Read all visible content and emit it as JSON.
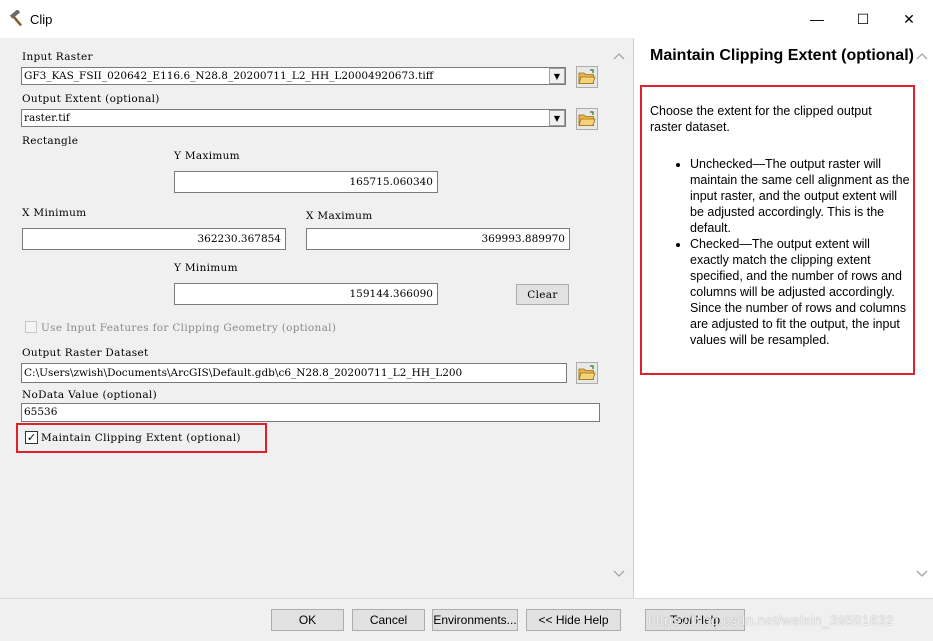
{
  "window": {
    "title": "Clip",
    "minimize": "—",
    "maximize": "☐",
    "close": "✕"
  },
  "form": {
    "input_raster_label": "Input Raster",
    "input_raster_value": "GF3_KAS_FSII_020642_E116.6_N28.8_20200711_L2_HH_L20004920673.tiff",
    "output_extent_label": "Output Extent (optional)",
    "output_extent_value": "raster.tif",
    "rectangle_label": "Rectangle",
    "y_max_label": "Y Maximum",
    "y_max_value": "165715.060340",
    "x_min_label": "X Minimum",
    "x_min_value": "362230.367854",
    "x_max_label": "X Maximum",
    "x_max_value": "369993.889970",
    "y_min_label": "Y Minimum",
    "y_min_value": "159144.366090",
    "clear_label": "Clear",
    "use_input_features_label": "Use Input Features for Clipping Geometry (optional)",
    "use_input_features_checked": false,
    "output_dataset_label": "Output Raster Dataset",
    "output_dataset_value": "C:\\Users\\zwish\\Documents\\ArcGIS\\Default.gdb\\c6_N28.8_20200711_L2_HH_L200",
    "nodata_label": "NoData Value (optional)",
    "nodata_value": "65536",
    "maintain_label": "Maintain Clipping Extent (optional)",
    "maintain_checked": true
  },
  "help": {
    "title": "Maintain Clipping Extent (optional)",
    "intro": "Choose the extent for the clipped output raster dataset.",
    "bullets": [
      "Unchecked—The output raster will maintain the same cell alignment as the input raster, and the output extent will be adjusted accordingly. This is the default.",
      "Checked—The output extent will exactly match the clipping extent specified, and the number of rows and columns will be adjusted accordingly. Since the number of rows and columns are adjusted to fit the output, the input values will be resampled."
    ]
  },
  "buttons": {
    "ok": "OK",
    "cancel": "Cancel",
    "environments": "Environments...",
    "hide_help": "<< Hide Help",
    "tool_help": "Tool Help"
  },
  "watermark": "https://blog.csdn.net/weixin_39591632",
  "colors": {
    "highlight": "#e0202a",
    "window_bg": "#f0f0f0"
  }
}
